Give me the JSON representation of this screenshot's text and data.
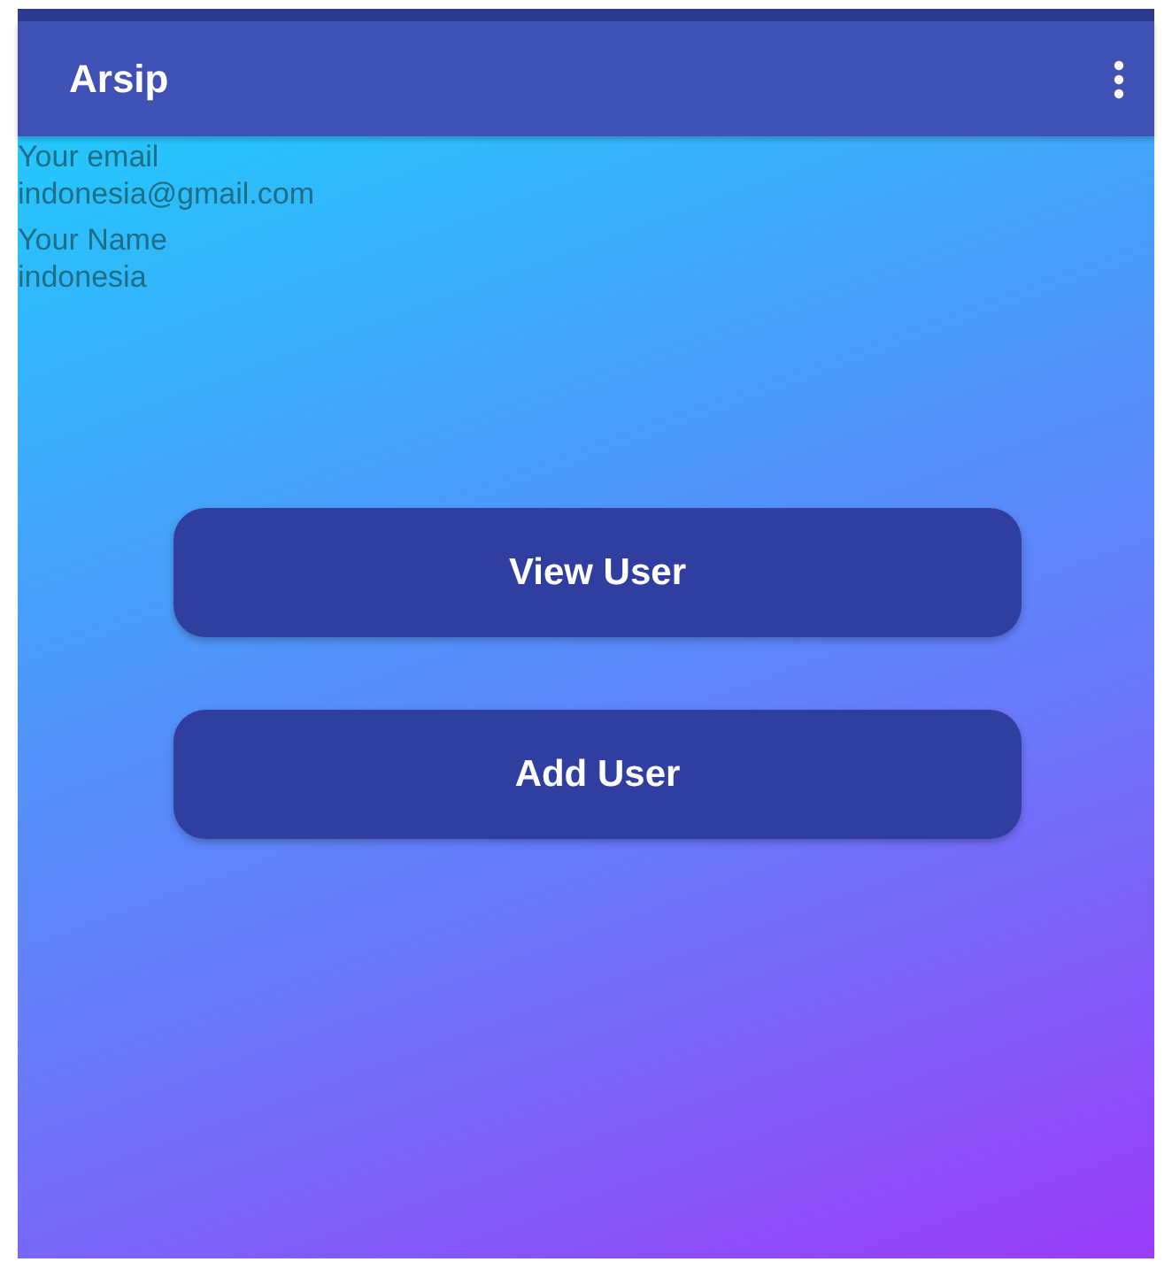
{
  "app_bar": {
    "title": "Arsip"
  },
  "profile": [
    {
      "label": "Your email",
      "value": "indonesia@gmail.com"
    },
    {
      "label": "Your Name",
      "value": "indonesia"
    }
  ],
  "buttons": [
    "View User",
    "Add User"
  ]
}
